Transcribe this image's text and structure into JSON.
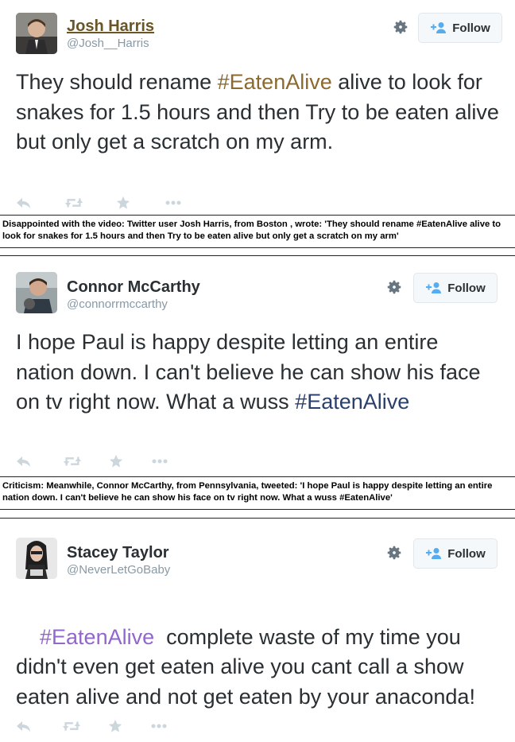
{
  "tweets": [
    {
      "name": "Josh Harris",
      "handle": "@Josh__Harris",
      "follow_label": "Follow",
      "text_before": "They should rename ",
      "hashtag": "#EatenAlive",
      "text_after": " alive to look for snakes for 1.5 hours and then Try to be eaten alive but only get a scratch on my arm."
    },
    {
      "name": "Connor McCarthy",
      "handle": "@connorrmccarthy",
      "follow_label": "Follow",
      "text_before": "I hope Paul is happy despite letting an entire nation down. I can't believe he can show his face on tv right now. What a wuss ",
      "hashtag": "#EatenAlive",
      "text_after": ""
    },
    {
      "name": "Stacey Taylor",
      "handle": "@NeverLetGoBaby",
      "follow_label": "Follow",
      "text_before": "",
      "hashtag": "#EatenAlive",
      "text_after": "  complete waste of my time you didn't even get eaten alive you cant call a show eaten alive and not get eaten by your anaconda!"
    }
  ],
  "captions": [
    "Disappointed with the video: Twitter user Josh Harris, from Boston , wrote: 'They should rename #EatenAlive alive to look for snakes for 1.5 hours and then Try to be eaten alive but only get a scratch on my arm'",
    "Criticism: Meanwhile, Connor McCarthy, from Pennsylvania, tweeted: 'I hope Paul is happy despite letting an entire nation down. I can't believe he can show his face on tv right now. What a wuss #EatenAlive'"
  ],
  "icons": {
    "reply": "reply-icon",
    "retweet": "retweet-icon",
    "favorite": "star-icon",
    "more": "more-icon",
    "settings": "gear-icon",
    "follow": "add-user-icon"
  },
  "colors": {
    "hashtag_1": "#8a6a2e",
    "hashtag_2": "#2b3f6b",
    "hashtag_3": "#9266cc",
    "follow_icon": "#55acee",
    "action_icons": "#ccd6dd"
  }
}
